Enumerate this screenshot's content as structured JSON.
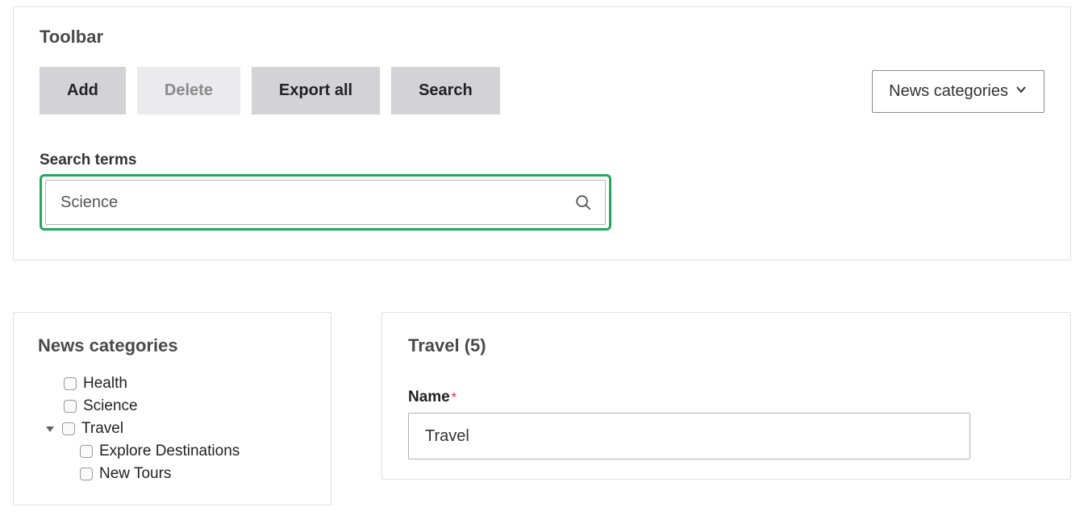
{
  "toolbar": {
    "title": "Toolbar",
    "buttons": {
      "add": "Add",
      "delete": "Delete",
      "export": "Export all",
      "search": "Search"
    },
    "dropdown_label": "News categories",
    "search_label": "Search terms",
    "search_value": "Science"
  },
  "tree": {
    "title": "News categories",
    "items": [
      {
        "label": "Health"
      },
      {
        "label": "Science"
      },
      {
        "label": "Travel",
        "expanded": true,
        "children": [
          {
            "label": "Explore Destinations"
          },
          {
            "label": "New Tours"
          }
        ]
      }
    ]
  },
  "detail": {
    "header": "Travel (5)",
    "name_label": "Name",
    "name_value": "Travel"
  }
}
